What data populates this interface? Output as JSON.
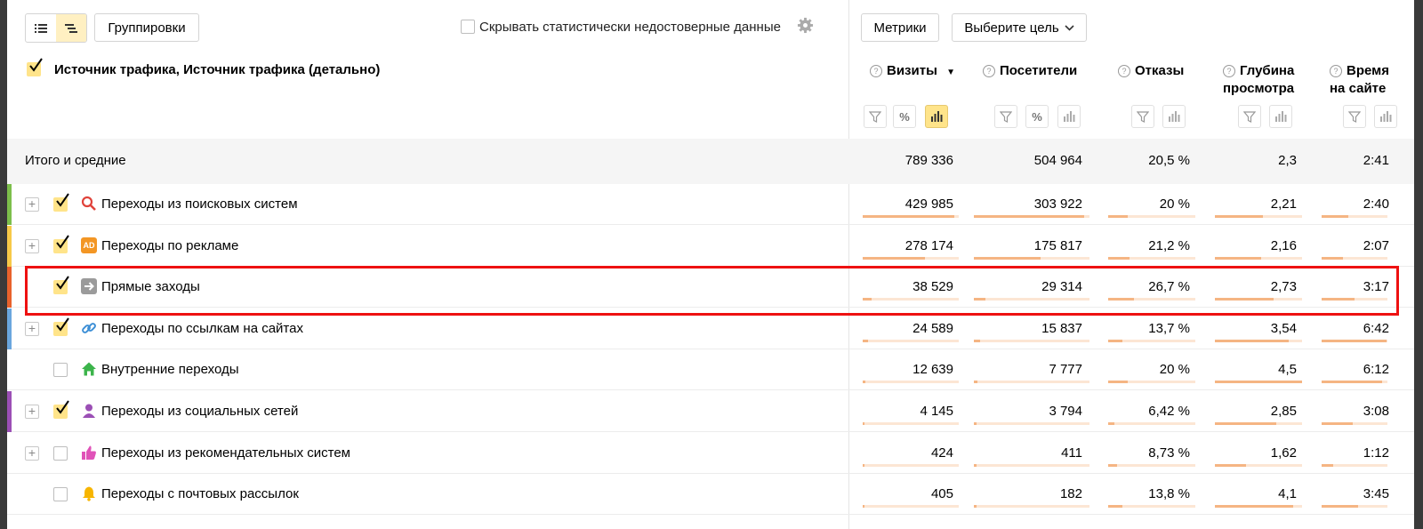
{
  "toolbar": {
    "groupings_label": "Группировки",
    "hide_unreliable_label": "Скрывать статистически недостоверные данные",
    "metrics_label": "Метрики",
    "goal_select_label": "Выберите цель"
  },
  "dimension_header": "Источник трафика, Источник трафика (детально)",
  "metrics": [
    {
      "label": "Визиты",
      "sorted": "▼"
    },
    {
      "label": "Посетители"
    },
    {
      "label": "Отказы"
    },
    {
      "label_line1": "Глубина",
      "label_line2": "просмотра"
    },
    {
      "label_line1": "Время",
      "label_line2": "на сайте"
    }
  ],
  "help_mark": "?",
  "totals": {
    "label": "Итого и средние",
    "values": [
      "789 336",
      "504 964",
      "20,5 %",
      "2,3",
      "2:41"
    ]
  },
  "rows": [
    {
      "label": "Переходы из поисковых систем",
      "icon": "search-icon",
      "stripe": "#7cbf4b",
      "expandable": true,
      "checked": true,
      "values": [
        "429 985",
        "303 922",
        "20 %",
        "2,21",
        "2:40"
      ],
      "fractions": [
        0.95,
        0.95,
        0.22,
        0.55,
        0.4
      ]
    },
    {
      "label": "Переходы по рекламе",
      "icon": "ad-icon",
      "icon_text": "AD",
      "stripe": "#f7c948",
      "expandable": true,
      "checked": true,
      "values": [
        "278 174",
        "175 817",
        "21,2 %",
        "2,16",
        "2:07"
      ],
      "fractions": [
        0.65,
        0.58,
        0.24,
        0.53,
        0.32
      ]
    },
    {
      "label": "Прямые заходы",
      "icon": "arrow-icon",
      "stripe": "#e8622c",
      "expandable": false,
      "checked": true,
      "values": [
        "38 529",
        "29 314",
        "26,7 %",
        "2,73",
        "3:17"
      ],
      "fractions": [
        0.09,
        0.1,
        0.3,
        0.67,
        0.5
      ]
    },
    {
      "label": "Переходы по ссылкам на сайтах",
      "icon": "link-icon",
      "stripe": "#6aa6de",
      "expandable": true,
      "checked": true,
      "values": [
        "24 589",
        "15 837",
        "13,7 %",
        "3,54",
        "6:42"
      ],
      "fractions": [
        0.06,
        0.05,
        0.16,
        0.85,
        0.98
      ]
    },
    {
      "label": "Внутренние переходы",
      "icon": "home-icon",
      "stripe": null,
      "expandable": false,
      "checked": false,
      "values": [
        "12 639",
        "7 777",
        "20 %",
        "4,5",
        "6:12"
      ],
      "fractions": [
        0.03,
        0.03,
        0.22,
        1.0,
        0.92
      ]
    },
    {
      "label": "Переходы из социальных сетей",
      "icon": "social-icon",
      "stripe": "#9b4fb5",
      "expandable": true,
      "checked": true,
      "values": [
        "4 145",
        "3 794",
        "6,42 %",
        "2,85",
        "3:08"
      ],
      "fractions": [
        0.01,
        0.01,
        0.07,
        0.7,
        0.47
      ]
    },
    {
      "label": "Переходы из рекомендательных систем",
      "icon": "thumbs-up-icon",
      "stripe": null,
      "expandable": true,
      "checked": false,
      "values": [
        "424",
        "411",
        "8,73 %",
        "1,62",
        "1:12"
      ],
      "fractions": [
        0.003,
        0.003,
        0.1,
        0.36,
        0.17
      ]
    },
    {
      "label": "Переходы с почтовых рассылок",
      "icon": "bell-icon",
      "stripe": null,
      "expandable": false,
      "checked": false,
      "values": [
        "405",
        "182",
        "13,8 %",
        "4,1",
        "3:45"
      ],
      "fractions": [
        0.003,
        0.002,
        0.16,
        0.9,
        0.56
      ]
    }
  ],
  "colors": {
    "accent": "#ffe48a",
    "bar": "#f5b583",
    "bar_track": "#fce6d4",
    "highlight": "#e11"
  }
}
